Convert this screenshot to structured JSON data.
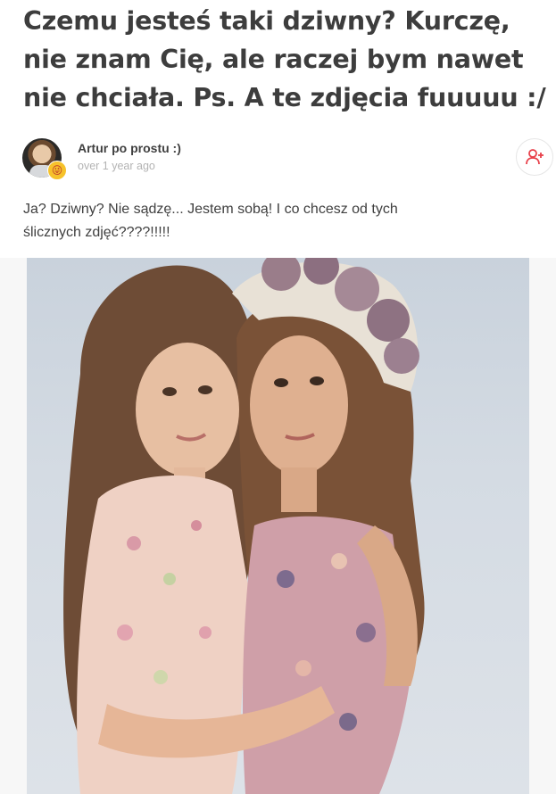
{
  "question": {
    "lines": [
      "Czemu jesteś taki dziwny? Kurczę,",
      "nie znam Cię, ale raczej bym nawet",
      "nie chciała. Ps. A te zdjęcia fuuuuu :/"
    ]
  },
  "author": {
    "name": "Artur po prostu :)",
    "time": "over 1 year ago",
    "emoji": "😜"
  },
  "answer": {
    "lines": [
      "Ja? Dziwny? Nie sądzę... Jestem sobą! I co chcesz od tych",
      "ślicznych zdjęć????!!!!!"
    ]
  },
  "icons": {
    "follow": "add-user-icon"
  },
  "colors": {
    "accent": "#e8414b",
    "text": "#3d3d3d",
    "muted": "#b3b3b3"
  }
}
